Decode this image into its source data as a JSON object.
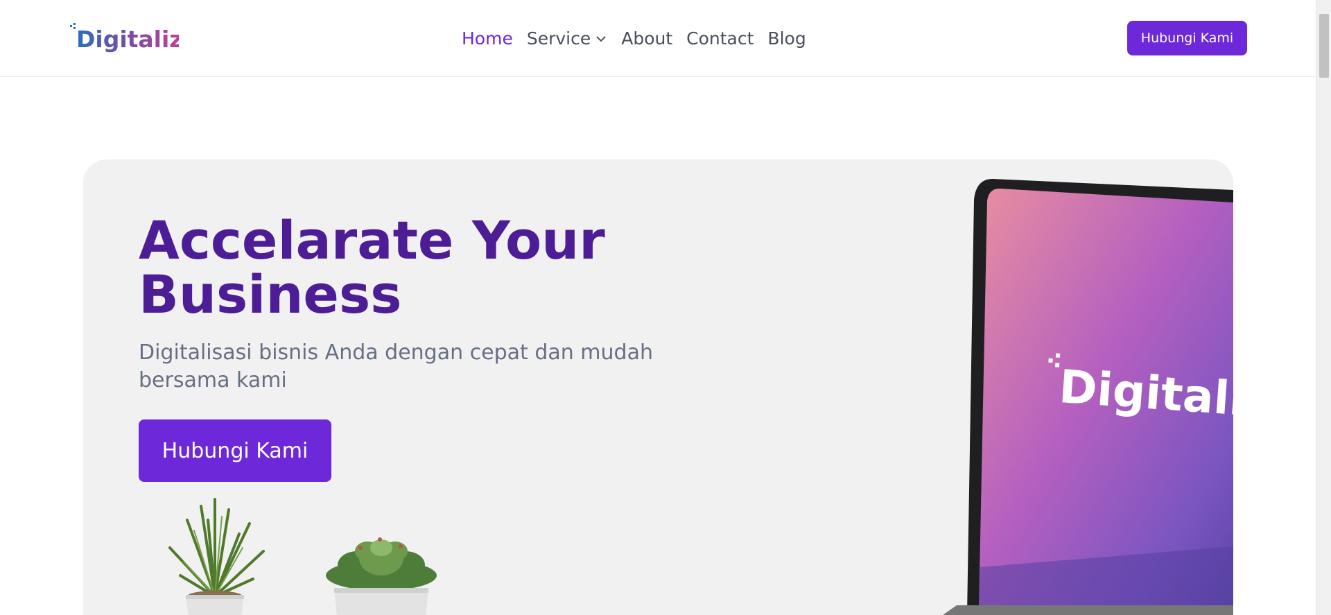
{
  "header": {
    "logo_text": "Digitaliz",
    "nav": [
      {
        "label": "Home",
        "active": true
      },
      {
        "label": "Service",
        "has_dropdown": true
      },
      {
        "label": "About"
      },
      {
        "label": "Contact"
      },
      {
        "label": "Blog"
      }
    ],
    "cta_label": "Hubungi Kami"
  },
  "hero": {
    "title": "Accelarate Your Business",
    "subtitle": "Digitalisasi bisnis Anda dengan cepat dan mudah bersama kami",
    "cta_label": "Hubungi Kami",
    "screen_logo_text": "Digitaliz"
  },
  "colors": {
    "accent": "#6d28d9",
    "title": "#4c1d95",
    "text_muted": "#667085",
    "hero_bg": "#f1f1f1"
  }
}
